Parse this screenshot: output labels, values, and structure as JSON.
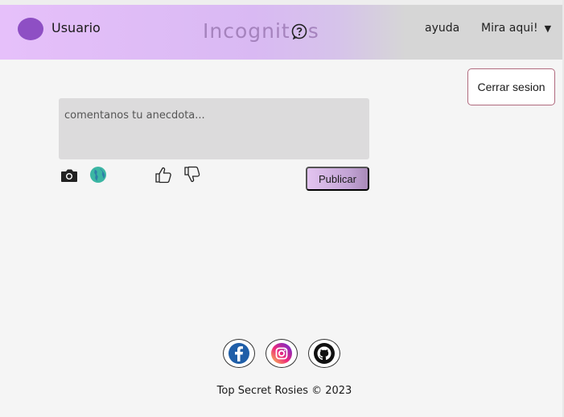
{
  "header": {
    "username": "Usuario",
    "logo_left": "Incognit",
    "logo_right": "s",
    "help_link": "ayuda",
    "menu_label": "Mira aqui!",
    "caret": "▼"
  },
  "logout_label": "Cerrar sesion",
  "composer": {
    "placeholder": "comentanos tu anecdota...",
    "publish_label": "Publicar"
  },
  "icons": [
    "camera-icon",
    "globe-icon",
    "thumbs-up-icon",
    "thumbs-down-icon",
    "facebook-icon",
    "instagram-icon",
    "github-icon"
  ],
  "colors": {
    "accent": "#8e4fc4",
    "header_gradient_start": "#e6c0fa",
    "header_gradient_end": "#d6d6d6",
    "logout_border": "#b06a7e"
  },
  "footer": {
    "text": "Top Secret Rosies © 2023"
  }
}
